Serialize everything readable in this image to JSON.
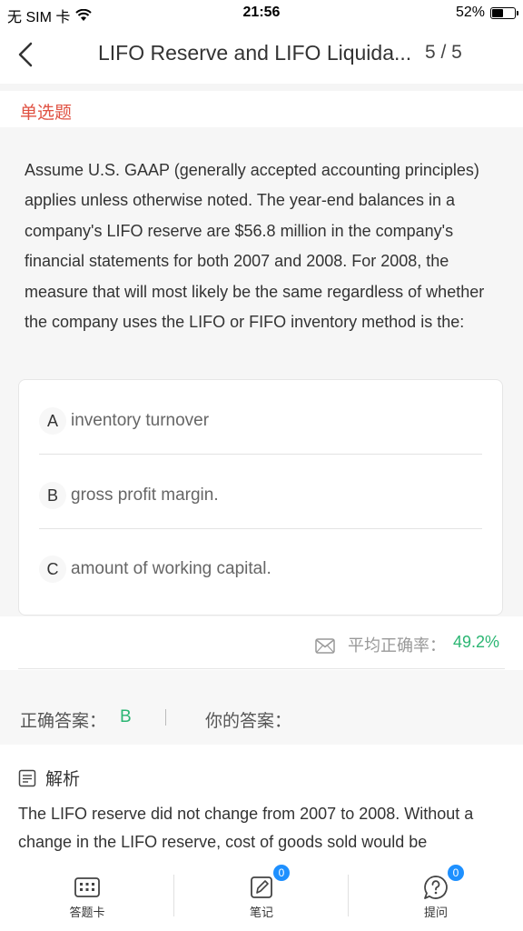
{
  "status_bar": {
    "carrier": "无 SIM 卡",
    "time": "21:56",
    "battery": "52%",
    "battery_level": 0.52
  },
  "nav": {
    "title": "LIFO Reserve and LIFO Liquida...",
    "count": "5 / 5"
  },
  "question": {
    "type": "单选题",
    "text": "Assume U.S. GAAP (generally accepted accounting principles) applies unless otherwise noted. The year-end balances in a company's LIFO reserve are $56.8 million in the company's financial statements for both 2007 and 2008. For 2008, the measure that will most likely be the same regardless of whether the company uses the LIFO or FIFO inventory method is the:",
    "options": [
      {
        "letter": "A",
        "text": "inventory turnover"
      },
      {
        "letter": "B",
        "text": "gross profit margin."
      },
      {
        "letter": "C",
        "text": "amount of working capital."
      }
    ]
  },
  "stats": {
    "label": "平均正确率：",
    "value": "49.2%"
  },
  "answer": {
    "correct_label": "正确答案：",
    "correct_value": "B",
    "yours_label": "你的答案："
  },
  "analysis": {
    "title": "解析",
    "text": "The LIFO reserve did not change from 2007 to 2008. Without a change in the LIFO reserve, cost of goods sold would be"
  },
  "tabbar": {
    "items": [
      {
        "label": "答题卡",
        "icon": "answer-card-icon"
      },
      {
        "label": "笔记",
        "icon": "note-icon",
        "badge": "0"
      },
      {
        "label": "提问",
        "icon": "question-icon",
        "badge": "0"
      }
    ]
  },
  "colors": {
    "accent_red": "#e05243",
    "accent_green": "#2bb673",
    "badge_blue": "#1e90ff"
  }
}
